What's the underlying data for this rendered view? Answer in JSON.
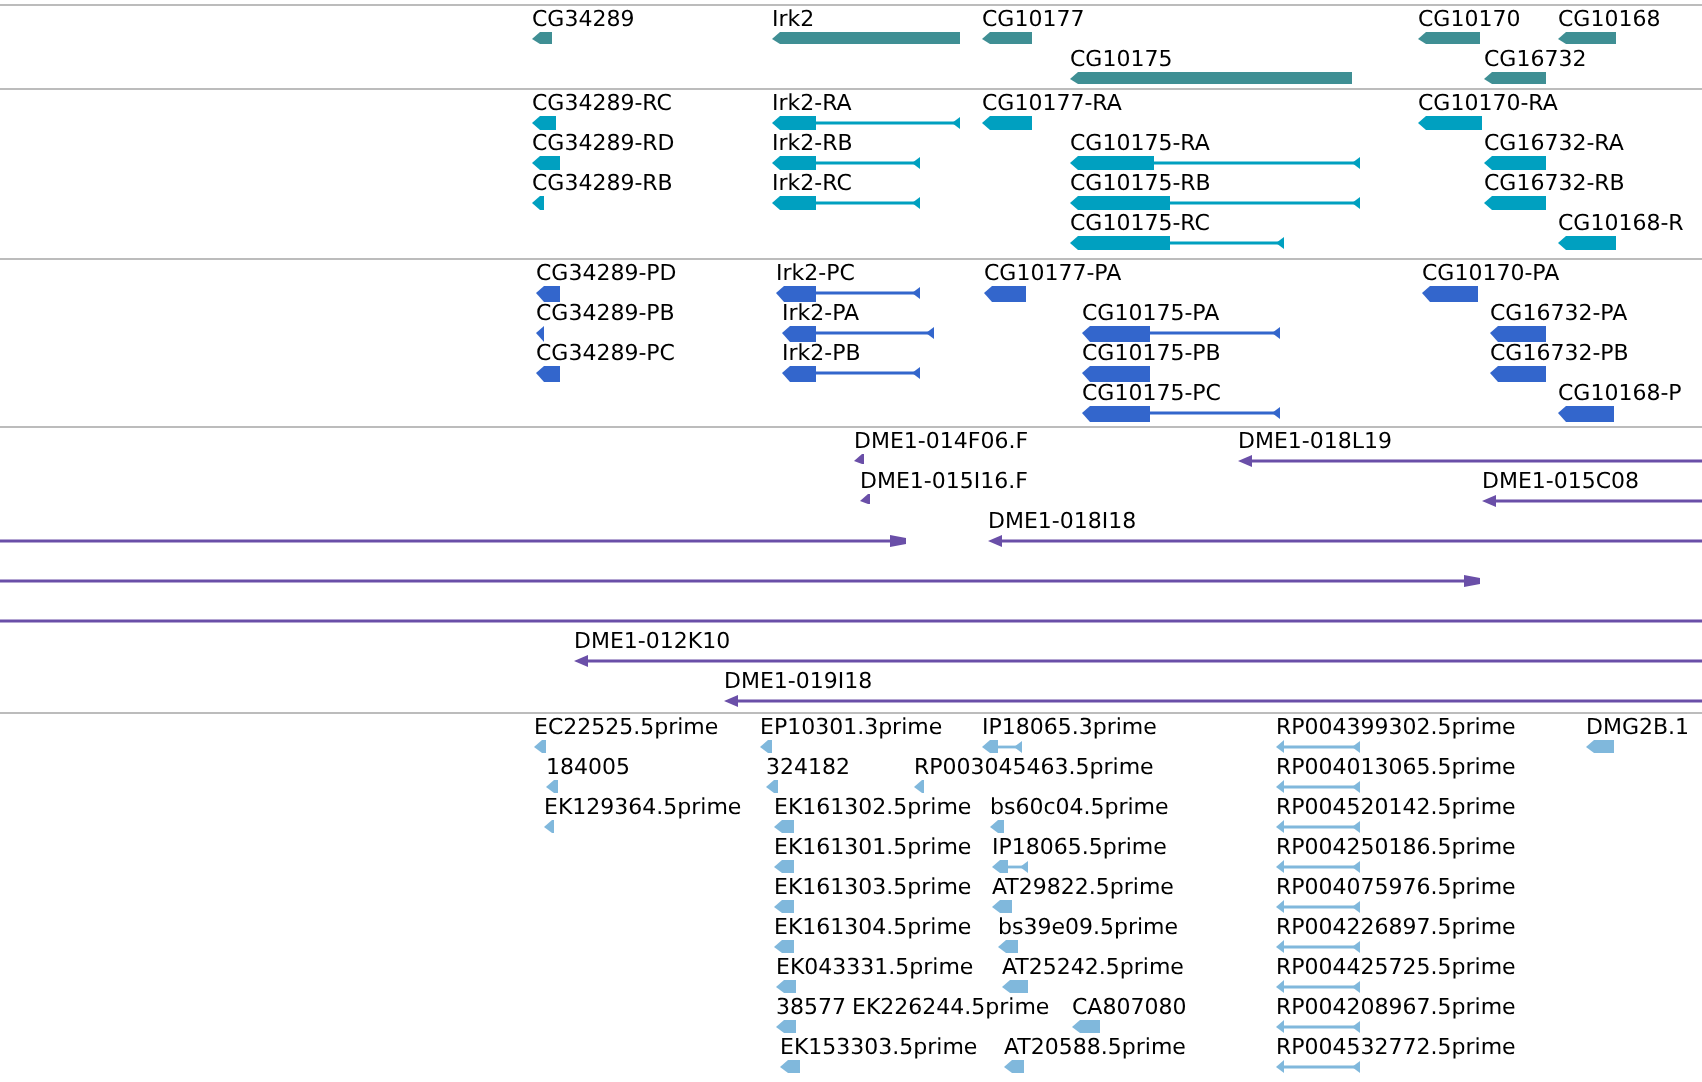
{
  "tracks": [
    {
      "kind": "genes",
      "color": "#3f8f94",
      "features": [
        {
          "label": "CG34289"
        },
        {
          "label": "Irk2"
        },
        {
          "label": "CG10177"
        },
        {
          "label": "CG10175"
        },
        {
          "label": "CG10170"
        },
        {
          "label": "CG10168"
        },
        {
          "label": "CG16732"
        }
      ]
    },
    {
      "kind": "transcripts",
      "color": "#00a0c0",
      "features": [
        {
          "label": "CG34289-RC"
        },
        {
          "label": "CG34289-RD"
        },
        {
          "label": "CG34289-RB"
        },
        {
          "label": "Irk2-RA"
        },
        {
          "label": "Irk2-RB"
        },
        {
          "label": "Irk2-RC"
        },
        {
          "label": "CG10177-RA"
        },
        {
          "label": "CG10175-RA"
        },
        {
          "label": "CG10175-RB"
        },
        {
          "label": "CG10175-RC"
        },
        {
          "label": "CG10170-RA"
        },
        {
          "label": "CG16732-RA"
        },
        {
          "label": "CG16732-RB"
        },
        {
          "label": "CG10168-R"
        }
      ]
    },
    {
      "kind": "proteins",
      "color": "#3366cc",
      "features": [
        {
          "label": "CG34289-PD"
        },
        {
          "label": "CG34289-PB"
        },
        {
          "label": "CG34289-PC"
        },
        {
          "label": "Irk2-PC"
        },
        {
          "label": "Irk2-PA"
        },
        {
          "label": "Irk2-PB"
        },
        {
          "label": "CG10177-PA"
        },
        {
          "label": "CG10175-PA"
        },
        {
          "label": "CG10175-PB"
        },
        {
          "label": "CG10175-PC"
        },
        {
          "label": "CG10170-PA"
        },
        {
          "label": "CG16732-PA"
        },
        {
          "label": "CG16732-PB"
        },
        {
          "label": "CG10168-P"
        }
      ]
    },
    {
      "kind": "clones",
      "color": "#6a4fa8",
      "features": [
        {
          "kind": "clone",
          "label": "DME1-014F06.F"
        },
        {
          "kind": "clone",
          "label": "DME1-015I16.F"
        },
        {
          "kind": "clone",
          "label": "DME1-018L19"
        },
        {
          "kind": "clone",
          "label": "DME1-015C08"
        },
        {
          "kind": "span"
        },
        {
          "kind": "clone",
          "label": "DME1-018I18"
        },
        {
          "kind": "span"
        },
        {
          "kind": "span"
        },
        {
          "kind": "clone",
          "label": "DME1-012K10"
        },
        {
          "kind": "clone",
          "label": "DME1-019I18"
        }
      ]
    },
    {
      "kind": "ests",
      "color": "#80b8dc",
      "features": [
        {
          "label": "EC22525.5prime"
        },
        {
          "label": "184005"
        },
        {
          "label": "EK129364.5prime"
        },
        {
          "label": "EP10301.3prime"
        },
        {
          "label": "324182"
        },
        {
          "label": "EK161302.5prime"
        },
        {
          "label": "EK161301.5prime"
        },
        {
          "label": "EK161303.5prime"
        },
        {
          "label": "EK161304.5prime"
        },
        {
          "label": "EK043331.5prime"
        },
        {
          "label": "38577"
        },
        {
          "label": "EK153303.5prime"
        },
        {
          "label": "IP18065.3prime"
        },
        {
          "label": "RP003045463.5prime"
        },
        {
          "label": "bs60c04.5prime"
        },
        {
          "label": "IP18065.5prime"
        },
        {
          "label": "AT29822.5prime"
        },
        {
          "label": "bs39e09.5prime"
        },
        {
          "label": "AT25242.5prime"
        },
        {
          "label": "EK226244.5prime"
        },
        {
          "label": "CA807080"
        },
        {
          "label": "AT20588.5prime"
        },
        {
          "label": "RP004399302.5prime"
        },
        {
          "label": "RP004013065.5prime"
        },
        {
          "label": "RP004520142.5prime"
        },
        {
          "label": "RP004250186.5prime"
        },
        {
          "label": "RP004075976.5prime"
        },
        {
          "label": "RP004226897.5prime"
        },
        {
          "label": "RP004425725.5prime"
        },
        {
          "label": "RP004208967.5prime"
        },
        {
          "label": "RP004532772.5prime"
        },
        {
          "label": "DMG2B.1"
        }
      ]
    }
  ]
}
